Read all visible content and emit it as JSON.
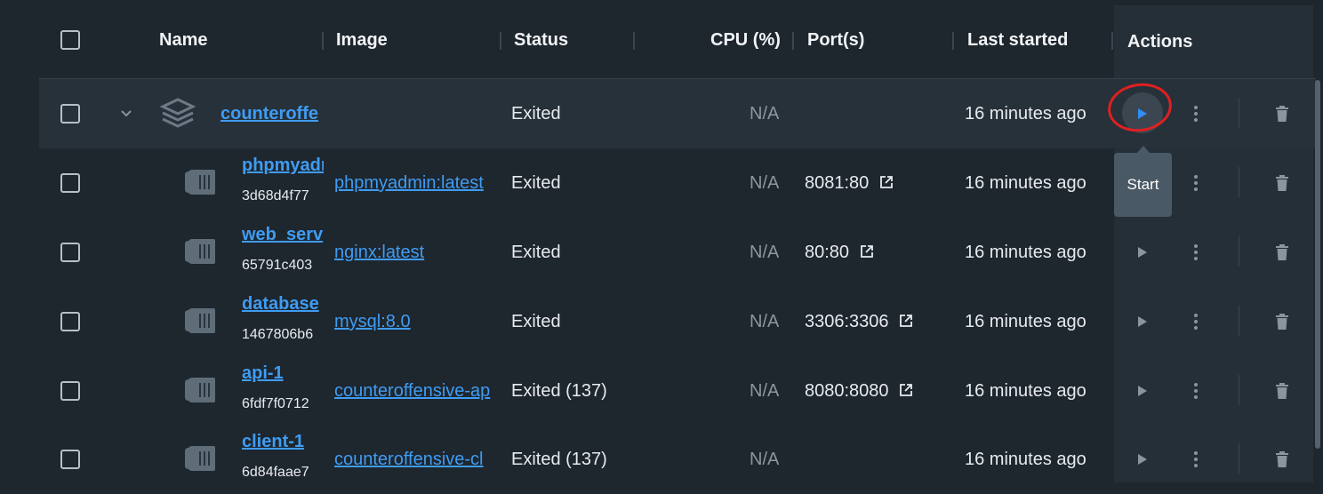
{
  "header": {
    "name": "Name",
    "image": "Image",
    "status": "Status",
    "cpu": "CPU (%)",
    "ports": "Port(s)",
    "last_started": "Last started",
    "actions": "Actions"
  },
  "group": {
    "name": "counteroffe",
    "status": "Exited",
    "cpu": "N/A",
    "last_started": "16 minutes ago"
  },
  "containers": [
    {
      "name": "phpmyadm",
      "id": "3d68d4f77",
      "image": "phpmyadmin:latest",
      "status": "Exited",
      "cpu": "N/A",
      "port": "8081:80",
      "last_started": "16 minutes ago"
    },
    {
      "name": "web_serv",
      "id": "65791c403",
      "image": "nginx:latest",
      "status": "Exited",
      "cpu": "N/A",
      "port": "80:80",
      "last_started": "16 minutes ago"
    },
    {
      "name": "database",
      "id": "1467806b6",
      "image": "mysql:8.0",
      "status": "Exited",
      "cpu": "N/A",
      "port": "3306:3306",
      "last_started": "16 minutes ago"
    },
    {
      "name": "api-1",
      "id": "6fdf7f0712",
      "image": "counteroffensive-ap",
      "status": "Exited (137)",
      "cpu": "N/A",
      "port": "8080:8080",
      "last_started": "16 minutes ago"
    },
    {
      "name": "client-1",
      "id": "6d84faae7",
      "image": "counteroffensive-cl",
      "status": "Exited (137)",
      "cpu": "N/A",
      "port": "",
      "last_started": "16 minutes ago"
    }
  ],
  "tooltip": {
    "label": "Start"
  },
  "colors": {
    "accent": "#3f9cf2",
    "annotation": "#e02020",
    "background": "#1e262e"
  }
}
